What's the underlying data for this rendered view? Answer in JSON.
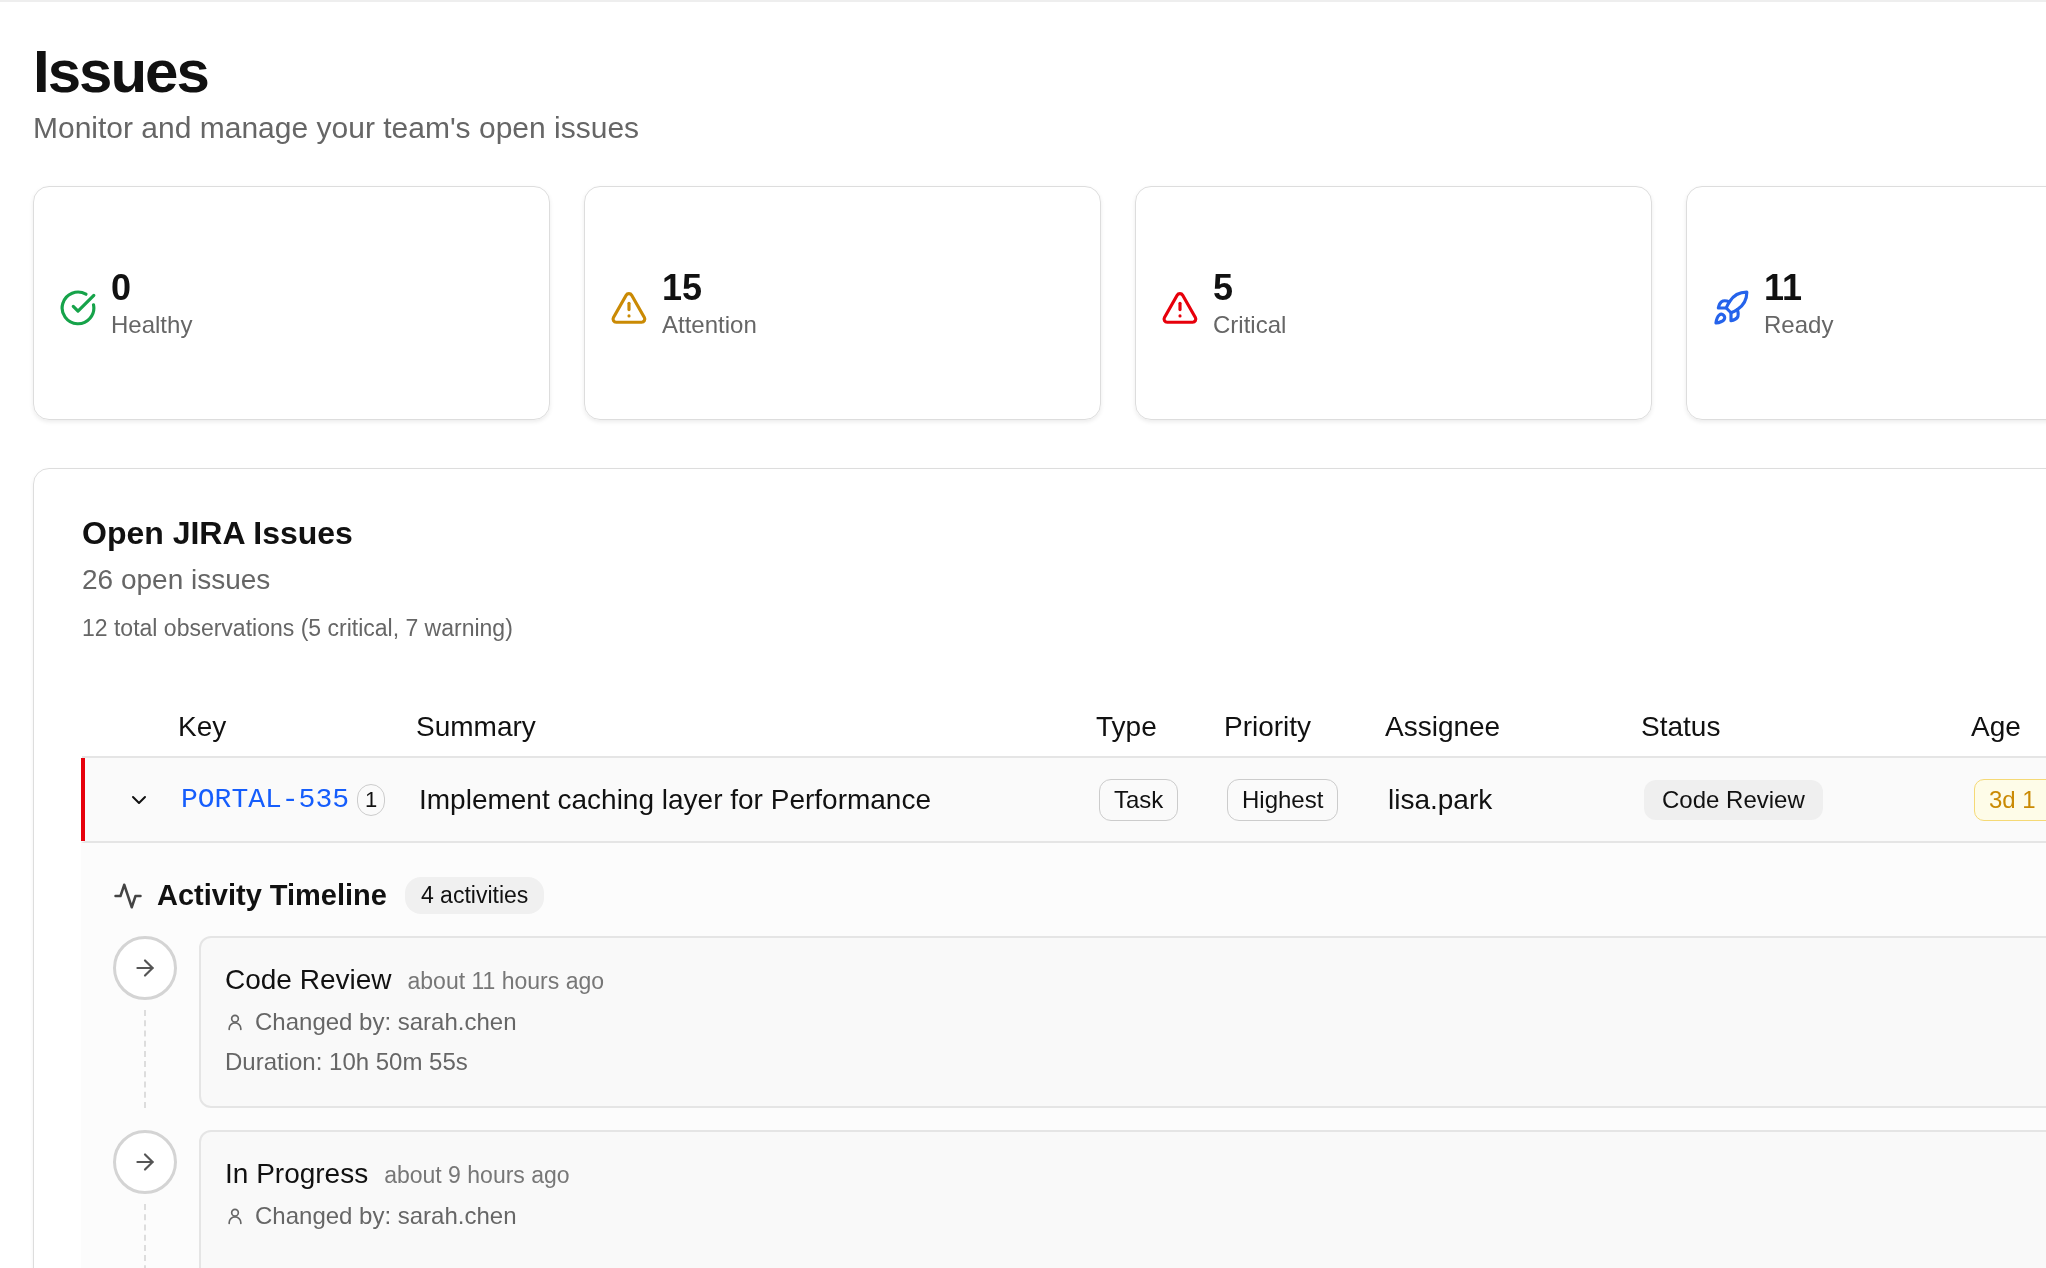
{
  "page": {
    "title": "Issues",
    "subtitle": "Monitor and manage your team's open issues"
  },
  "stats": [
    {
      "kind": "healthy",
      "value": "0",
      "label": "Healthy",
      "color": "#16a34a"
    },
    {
      "kind": "attention",
      "value": "15",
      "label": "Attention",
      "color": "#ca8a04"
    },
    {
      "kind": "critical",
      "value": "5",
      "label": "Critical",
      "color": "#e7000b"
    },
    {
      "kind": "ready",
      "value": "11",
      "label": "Ready",
      "color": "#2563eb"
    }
  ],
  "issues_panel": {
    "title": "Open JIRA Issues",
    "count": "26 open issues",
    "observations": "12 total observations (5 critical, 7 warning)",
    "table": {
      "columns": [
        "Key",
        "Summary",
        "Type",
        "Priority",
        "Assignee",
        "Status",
        "Age"
      ],
      "rows": [
        {
          "expanded": true,
          "color": "#e7000b",
          "key": "PORTAL-535",
          "comment_count": "1",
          "summary": "Implement caching layer for Performance",
          "type": "Task",
          "priority": "Highest",
          "assignee": "lisa.park",
          "status": "Code Review",
          "age": "3d 1"
        }
      ]
    },
    "timeline": {
      "title": "Activity Timeline",
      "badge": "4 activities",
      "activities": [
        {
          "status": "Code Review",
          "time": "about 11 hours ago",
          "changed_by": "Changed by: sarah.chen",
          "duration": "Duration: 10h 50m 55s"
        },
        {
          "status": "In Progress",
          "time": "about 9 hours ago",
          "changed_by": "Changed by: sarah.chen"
        }
      ]
    }
  }
}
